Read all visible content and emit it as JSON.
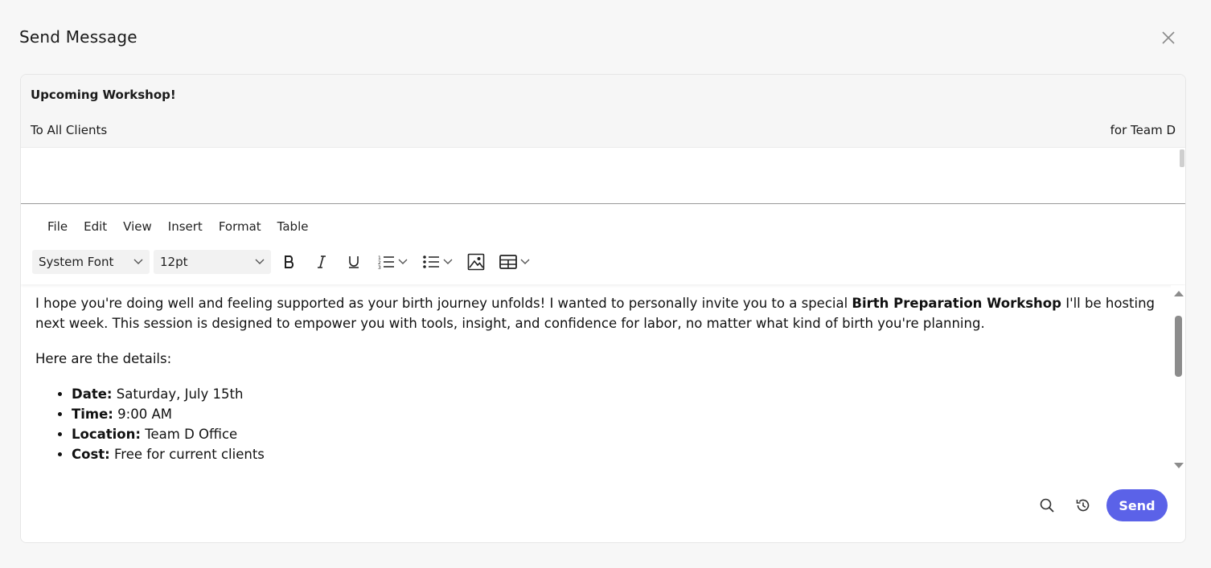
{
  "modal": {
    "title": "Send Message"
  },
  "message": {
    "subject": "Upcoming Workshop!",
    "recipient": "To All Clients",
    "team": "for Team D"
  },
  "editor": {
    "menu": [
      "File",
      "Edit",
      "View",
      "Insert",
      "Format",
      "Table"
    ],
    "font_family": "System Font",
    "font_size": "12pt",
    "body": {
      "p1_before": "I hope you're doing well and feeling supported as your birth journey unfolds! I wanted to personally invite you to a special ",
      "p1_bold": "Birth Preparation Workshop",
      "p1_after": " I'll be hosting next week. This session is designed to empower you with tools, insight, and confidence for labor, no matter what kind of birth you're planning.",
      "p2": "Here are the details:",
      "details": [
        {
          "label": "Date:",
          "value": " Saturday, July 15th"
        },
        {
          "label": "Time:",
          "value": " 9:00 AM"
        },
        {
          "label": "Location:",
          "value": " Team D Office"
        },
        {
          "label": "Cost:",
          "value": " Free for current clients"
        }
      ]
    }
  },
  "footer": {
    "send_label": "Send"
  },
  "colors": {
    "accent": "#5b62e8",
    "background": "#f7f7f7"
  }
}
